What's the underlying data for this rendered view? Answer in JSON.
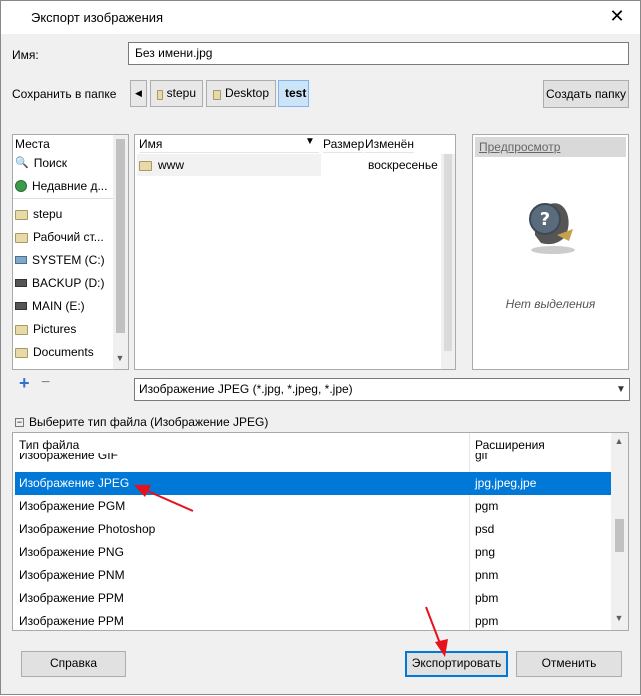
{
  "window": {
    "title": "Экспорт изображения",
    "close_icon": "close-icon"
  },
  "name_field": {
    "label": "Имя:",
    "value": "Без имени.jpg"
  },
  "save_in": {
    "label": "Сохранить в папке",
    "breadcrumbs": [
      "stepu",
      "Desktop",
      "test"
    ],
    "create_folder": "Создать папку"
  },
  "places": {
    "header": "Места",
    "items": [
      {
        "label": "Поиск",
        "icon": "search-icon"
      },
      {
        "label": "Недавние д...",
        "icon": "recent-icon"
      },
      {
        "label": "stepu",
        "icon": "folder-icon"
      },
      {
        "label": "Рабочий ст...",
        "icon": "folder-icon"
      },
      {
        "label": "SYSTEM (C:)",
        "icon": "drive-icon"
      },
      {
        "label": "BACKUP (D:)",
        "icon": "drive-icon"
      },
      {
        "label": "MAIN (E:)",
        "icon": "drive-icon"
      },
      {
        "label": "Pictures",
        "icon": "folder-icon"
      },
      {
        "label": "Documents",
        "icon": "folder-icon"
      }
    ],
    "add_label": "+",
    "remove_label": "−"
  },
  "files": {
    "columns": {
      "name": "Имя",
      "size": "Размер",
      "modified": "Изменён"
    },
    "rows": [
      {
        "name": "www",
        "size": "",
        "modified": "воскресенье"
      }
    ]
  },
  "preview": {
    "header": "Предпросмотр",
    "empty_text": "Нет выделения"
  },
  "filter": {
    "value": "Изображение JPEG (*.jpg, *.jpeg, *.jpe)"
  },
  "file_type": {
    "toggle": "Выберите тип файла (Изображение JPEG)",
    "columns": {
      "type": "Тип файла",
      "ext": "Расширения"
    },
    "rows": [
      {
        "type": "Изображение GIF",
        "ext": "gif"
      },
      {
        "type": "Изображение JPEG",
        "ext": "jpg,jpeg,jpe"
      },
      {
        "type": "Изображение PGM",
        "ext": "pgm"
      },
      {
        "type": "Изображение Photoshop",
        "ext": "psd"
      },
      {
        "type": "Изображение PNG",
        "ext": "png"
      },
      {
        "type": "Изображение PNM",
        "ext": "pnm"
      },
      {
        "type": "Изображение PPM",
        "ext": "pbm"
      },
      {
        "type": "Изображение PPM",
        "ext": "ppm"
      }
    ],
    "selected_index": 1
  },
  "buttons": {
    "help": "Справка",
    "export": "Экспортировать",
    "cancel": "Отменить"
  },
  "colors": {
    "selection": "#0078d7",
    "annotation_arrow": "#e8101a"
  }
}
